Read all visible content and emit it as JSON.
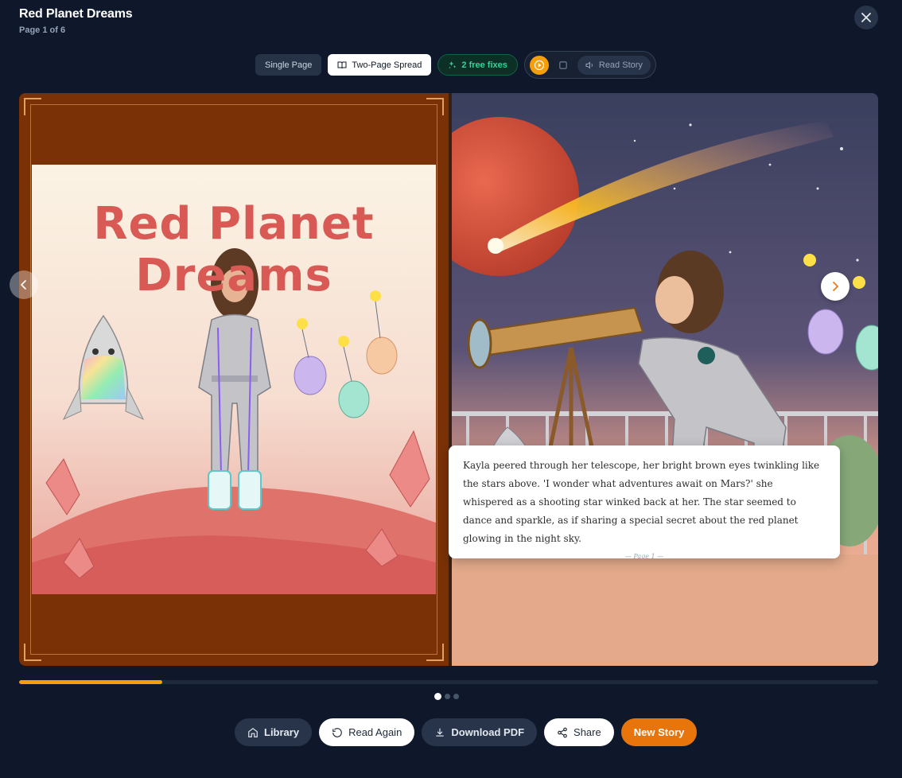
{
  "header": {
    "title": "Red Planet Dreams",
    "page_indicator": "Page 1 of 6"
  },
  "toolbar": {
    "single_page_label": "Single Page",
    "two_page_label": "Two-Page Spread",
    "free_fixes_label": "2 free fixes",
    "read_story_label": "Read Story"
  },
  "book": {
    "cover_title": "Red Planet Dreams",
    "story_text": "Kayla peered through her telescope, her bright brown eyes twinkling like the stars above. 'I wonder what adventures await on Mars?' she whispered as a shooting star winked back at her. The star seemed to dance and sparkle, as if sharing a special secret about the red planet glowing in the night sky.",
    "page_marker": "— Page 1 —"
  },
  "progress": {
    "fraction": 0.1667
  },
  "pagination": {
    "count": 3,
    "active": 0
  },
  "footer": {
    "library_label": "Library",
    "read_again_label": "Read Again",
    "download_label": "Download PDF",
    "share_label": "Share",
    "new_story_label": "New Story"
  },
  "colors": {
    "background": "#0f172a",
    "accent": "#f59e0b",
    "new_story": "#e8740c",
    "cover_border": "#7a3106",
    "free_fixes": "#34d399"
  },
  "icons": [
    "close-icon",
    "open-book-icon",
    "sparkle-icon",
    "play-icon",
    "stop-icon",
    "speaker-icon",
    "chevron-left-icon",
    "chevron-right-icon",
    "home-icon",
    "rotate-ccw-icon",
    "download-icon",
    "share-icon"
  ]
}
